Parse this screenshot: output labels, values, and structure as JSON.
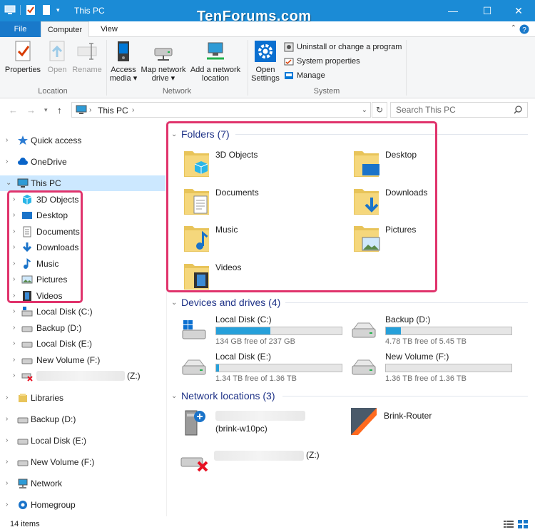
{
  "window": {
    "title": "This PC",
    "watermark": "TenForums.com",
    "minimize": "—",
    "maximize": "☐",
    "close": "✕"
  },
  "ribbon_tabs": {
    "file": "File",
    "computer": "Computer",
    "view": "View"
  },
  "ribbon": {
    "properties": "Properties",
    "open": "Open",
    "rename": "Rename",
    "location_group": "Location",
    "access_media_1": "Access",
    "access_media_2": "media ▾",
    "map_network_1": "Map network",
    "map_network_2": "drive ▾",
    "add_network_1": "Add a network",
    "add_network_2": "location",
    "network_group": "Network",
    "open_settings_1": "Open",
    "open_settings_2": "Settings",
    "uninstall": "Uninstall or change a program",
    "system_properties": "System properties",
    "manage": "Manage",
    "system_group": "System"
  },
  "address": {
    "path": "This PC",
    "search_placeholder": "Search This PC"
  },
  "nav": {
    "quick_access": "Quick access",
    "onedrive": "OneDrive",
    "this_pc": "This PC",
    "objects_3d": "3D Objects",
    "desktop": "Desktop",
    "documents": "Documents",
    "downloads": "Downloads",
    "music": "Music",
    "pictures": "Pictures",
    "videos": "Videos",
    "local_disk_c": "Local Disk (C:)",
    "backup_d": "Backup (D:)",
    "local_disk_e": "Local Disk (E:)",
    "new_volume_f": "New Volume (F:)",
    "z_drive": "(Z:)",
    "libraries": "Libraries",
    "backup_d_root": "Backup (D:)",
    "local_disk_e_root": "Local Disk (E:)",
    "new_volume_f_root": "New Volume (F:)",
    "network": "Network",
    "homegroup": "Homegroup"
  },
  "folders": {
    "header": "Folders (7)",
    "items": [
      "3D Objects",
      "Desktop",
      "Documents",
      "Downloads",
      "Music",
      "Pictures",
      "Videos"
    ]
  },
  "drives": {
    "header": "Devices and drives (4)",
    "items": [
      {
        "name": "Local Disk (C:)",
        "free": "134 GB free of 237 GB",
        "used_fraction": 0.43
      },
      {
        "name": "Backup (D:)",
        "free": "4.78 TB free of 5.45 TB",
        "used_fraction": 0.12
      },
      {
        "name": "Local Disk (E:)",
        "free": "1.34 TB free of 1.36 TB",
        "used_fraction": 0.02
      },
      {
        "name": "New Volume (F:)",
        "free": "1.36 TB free of 1.36 TB",
        "used_fraction": 0.0
      }
    ]
  },
  "network_locations": {
    "header": "Network locations (3)",
    "items": [
      "(brink-w10pc)",
      "Brink-Router",
      "(Z:)"
    ]
  },
  "status": {
    "count": "14 items"
  },
  "colors": {
    "titlebar": "#1b8bd6",
    "accent": "#1979ca",
    "highlight": "#e0336c",
    "section_header": "#1e3287",
    "drive_fill": "#26a0da",
    "selected": "#cce8ff"
  }
}
